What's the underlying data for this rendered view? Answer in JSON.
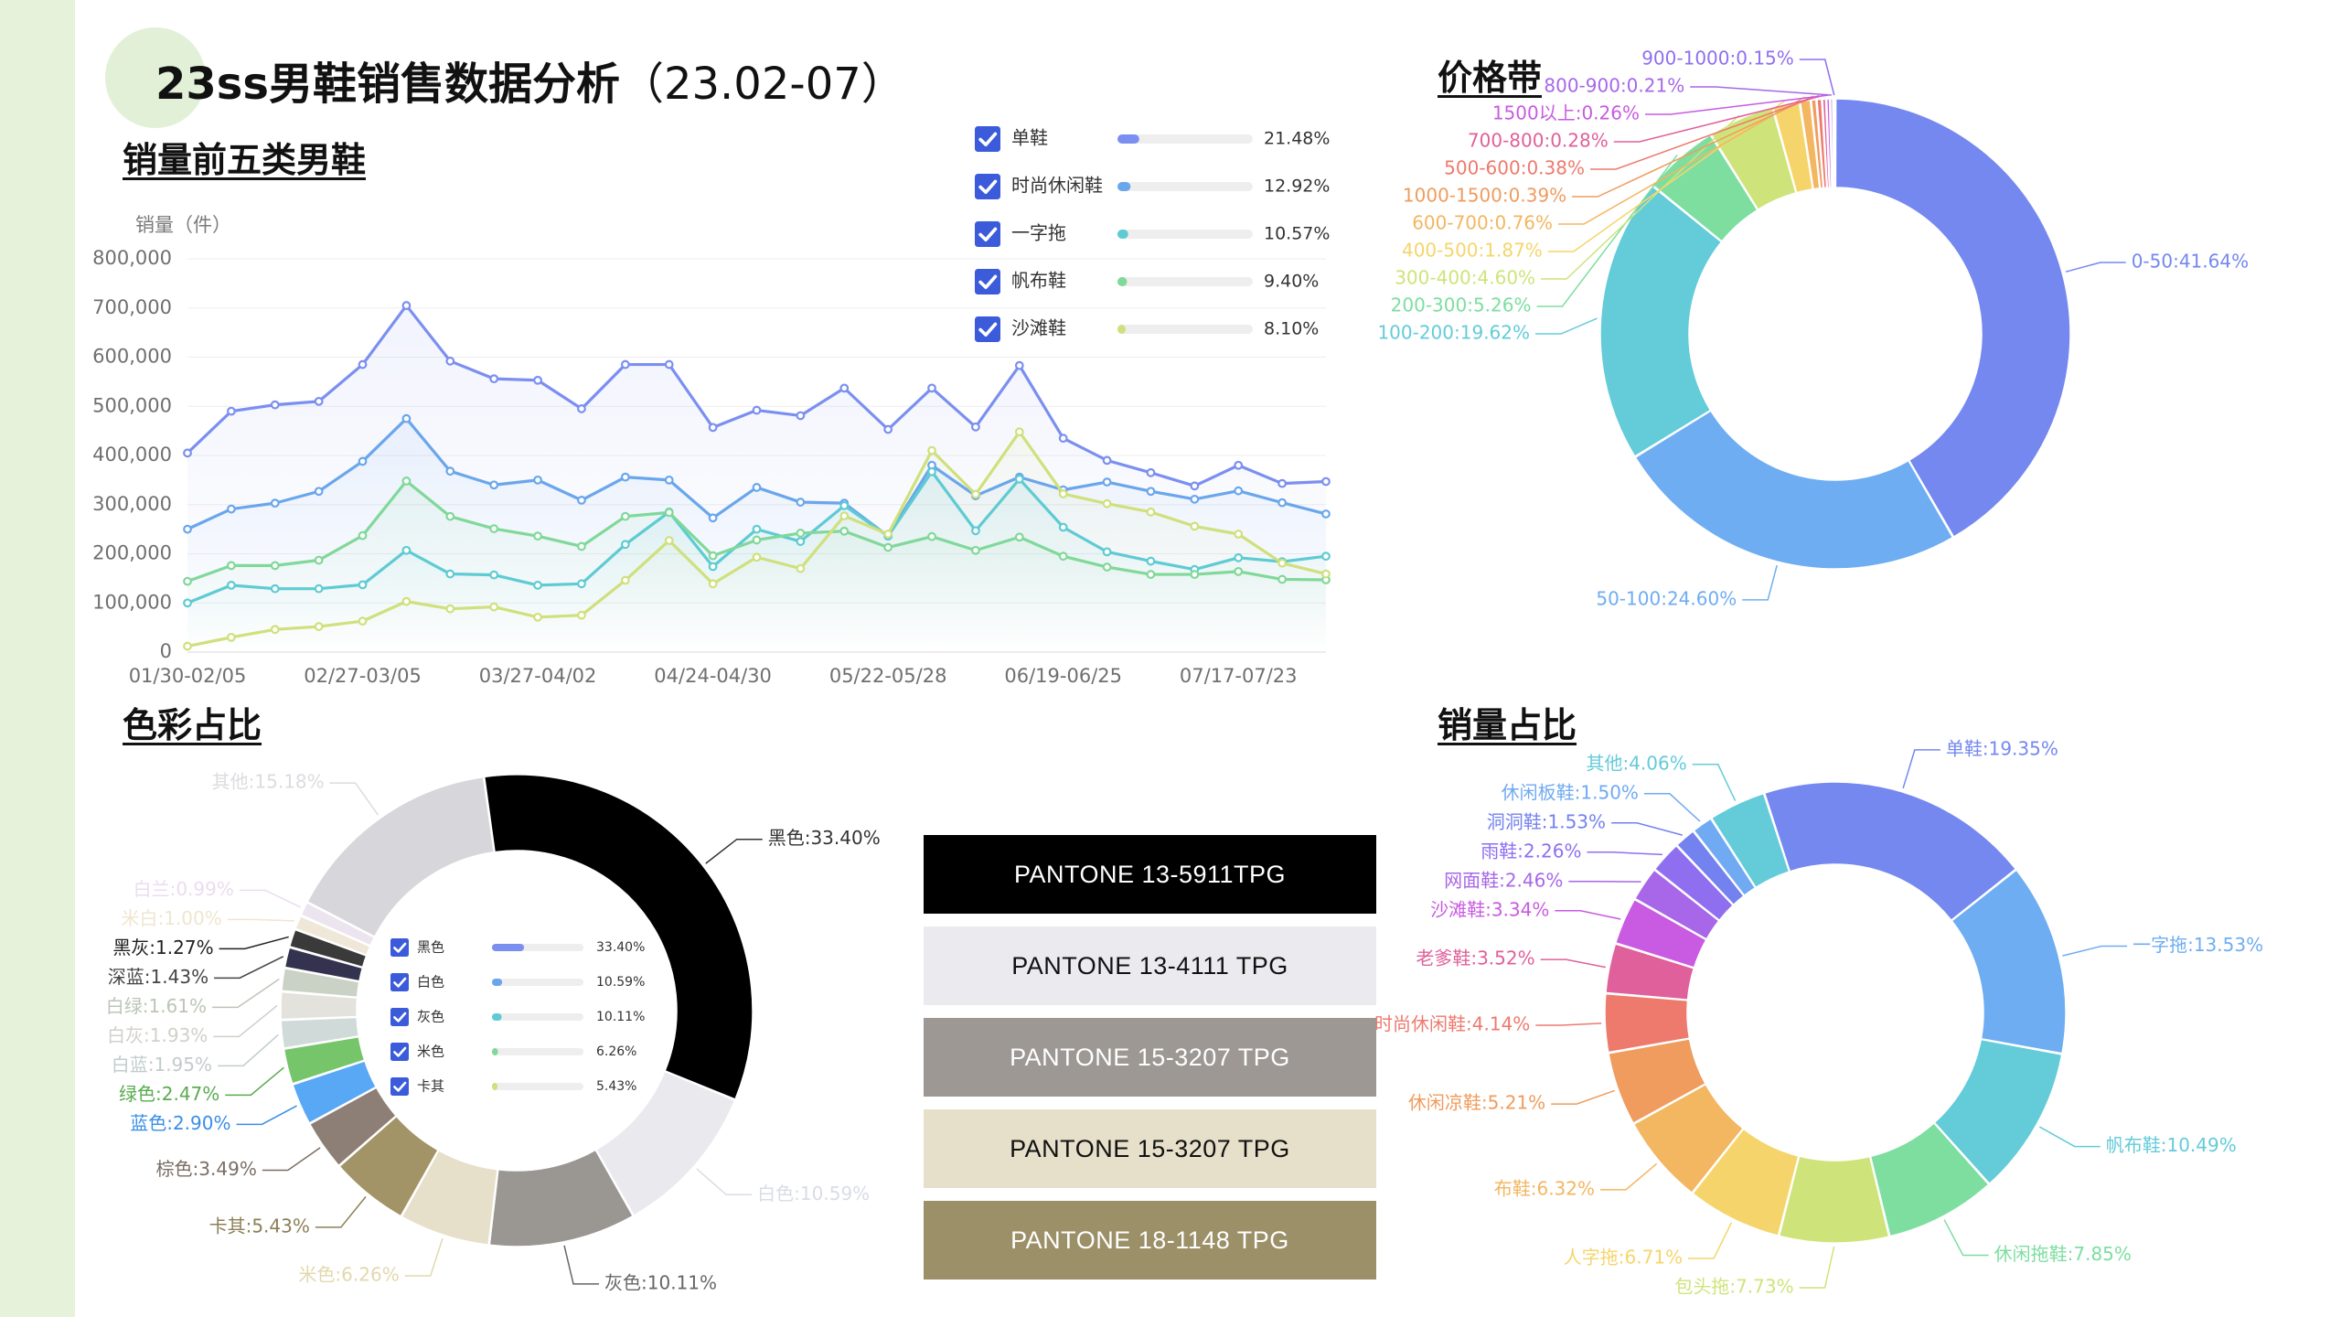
{
  "page": {
    "title_main": "23ss男鞋销售数据分析",
    "title_range": "（23.02-07）"
  },
  "sections": {
    "top5": "销量前五类男鞋",
    "price": "价格带",
    "color": "色彩占比",
    "share": "销量占比"
  },
  "pantone": [
    {
      "label": "PANTONE 13-5911TPG",
      "bg": "#000000",
      "fg": "#ffffff"
    },
    {
      "label": "PANTONE 13-4111 TPG",
      "bg": "#ebebef",
      "fg": "#111111"
    },
    {
      "label": "PANTONE 15-3207 TPG",
      "bg": "#9e9894",
      "fg": "#ffffff"
    },
    {
      "label": "PANTONE 15-3207 TPG",
      "bg": "#e6dfc9",
      "fg": "#111111"
    },
    {
      "label": "PANTONE 18-1148 TPG",
      "bg": "#9c9068",
      "fg": "#ffffff"
    }
  ],
  "chart_data": [
    {
      "id": "line",
      "type": "line",
      "ylabel": "销量（件）",
      "ylim": [
        0,
        800000
      ],
      "yticks": [
        0,
        100000,
        200000,
        300000,
        400000,
        500000,
        600000,
        700000,
        800000
      ],
      "ytick_labels": [
        "0",
        "100,000",
        "200,000",
        "300,000",
        "400,000",
        "500,000",
        "600,000",
        "700,000",
        "800,000"
      ],
      "x_tick_labels": [
        "01/30-02/05",
        "02/27-03/05",
        "03/27-04/02",
        "04/24-04/30",
        "05/22-05/28",
        "06/19-06/25",
        "07/17-07/23"
      ],
      "grid": true,
      "legend_position": "top-right",
      "series": [
        {
          "name": "单鞋",
          "color": "#7b8ff0",
          "pct_label": "21.48%",
          "pct": 21.48,
          "values": [
            405000,
            490000,
            503000,
            510000,
            585000,
            705000,
            592000,
            556000,
            553000,
            495000,
            585000,
            585000,
            457000,
            492000,
            481000,
            537000,
            453000,
            537000,
            458000,
            583000,
            435000,
            390000,
            365000,
            338000,
            380000,
            343000,
            347000
          ]
        },
        {
          "name": "时尚休闲鞋",
          "color": "#6aa6ec",
          "pct_label": "12.92%",
          "pct": 12.92,
          "values": [
            250000,
            291000,
            303000,
            327000,
            388000,
            475000,
            368000,
            340000,
            350000,
            309000,
            356000,
            350000,
            273000,
            335000,
            305000,
            303000,
            236000,
            380000,
            318000,
            356000,
            330000,
            346000,
            327000,
            311000,
            328000,
            304000,
            281000
          ]
        },
        {
          "name": "一字拖",
          "color": "#5ecbd3",
          "pct_label": "10.57%",
          "pct": 10.57,
          "values": [
            100000,
            136000,
            129000,
            129000,
            137000,
            207000,
            159000,
            157000,
            136000,
            139000,
            219000,
            285000,
            174000,
            250000,
            225000,
            298000,
            236000,
            367000,
            247000,
            352000,
            254000,
            204000,
            185000,
            168000,
            192000,
            184000,
            195000
          ]
        },
        {
          "name": "帆布鞋",
          "color": "#80d899",
          "pct_label": "9.40%",
          "pct": 9.4,
          "values": [
            144000,
            176000,
            176000,
            187000,
            237000,
            348000,
            276000,
            251000,
            236000,
            215000,
            276000,
            284000,
            196000,
            228000,
            242000,
            246000,
            213000,
            235000,
            207000,
            234000,
            195000,
            173000,
            158000,
            158000,
            164000,
            148000,
            147000
          ]
        },
        {
          "name": "沙滩鞋",
          "color": "#cfe07c",
          "pct_label": "8.10%",
          "pct": 8.1,
          "values": [
            12000,
            30000,
            46000,
            52000,
            63000,
            103000,
            88000,
            92000,
            71000,
            75000,
            146000,
            227000,
            139000,
            193000,
            170000,
            277000,
            240000,
            410000,
            321000,
            448000,
            322000,
            302000,
            285000,
            256000,
            240000,
            181000,
            159000
          ]
        }
      ]
    },
    {
      "id": "price",
      "type": "pie",
      "donut": true,
      "slices": [
        {
          "label": "0-50:41.64%",
          "value": 41.64,
          "color": "#7488f0"
        },
        {
          "label": "50-100:24.60%",
          "value": 24.6,
          "color": "#6fadf2"
        },
        {
          "label": "100-200:19.62%",
          "value": 19.62,
          "color": "#64cbd9"
        },
        {
          "label": "200-300:5.26%",
          "value": 5.26,
          "color": "#7ddea0"
        },
        {
          "label": "300-400:4.60%",
          "value": 4.6,
          "color": "#cee47a"
        },
        {
          "label": "400-500:1.87%",
          "value": 1.87,
          "color": "#f5d56b"
        },
        {
          "label": "600-700:0.76%",
          "value": 0.76,
          "color": "#f3b661"
        },
        {
          "label": "1000-1500:0.39%",
          "value": 0.39,
          "color": "#ef9c5e"
        },
        {
          "label": "500-600:0.38%",
          "value": 0.38,
          "color": "#ee7a6e"
        },
        {
          "label": "700-800:0.28%",
          "value": 0.28,
          "color": "#e0609b"
        },
        {
          "label": "1500以上:0.26%",
          "value": 0.26,
          "color": "#c95ae2"
        },
        {
          "label": "800-900:0.21%",
          "value": 0.21,
          "color": "#a767e8"
        },
        {
          "label": "900-1000:0.15%",
          "value": 0.15,
          "color": "#8f6ff0"
        }
      ]
    },
    {
      "id": "color",
      "type": "pie",
      "donut": true,
      "legend_position": "inside-center",
      "slices": [
        {
          "label": "黑色:33.40%",
          "value": 33.4,
          "color": "#000000",
          "label_color": "#333333"
        },
        {
          "label": "白色:10.59%",
          "value": 10.59,
          "color": "#e9e9ee",
          "label_color": "#d9dce6"
        },
        {
          "label": "灰色:10.11%",
          "value": 10.11,
          "color": "#9a9692",
          "label_color": "#666666"
        },
        {
          "label": "米色:6.26%",
          "value": 6.26,
          "color": "#e6dfc9",
          "label_color": "#e2d8ad"
        },
        {
          "label": "卡其:5.43%",
          "value": 5.43,
          "color": "#a39468",
          "label_color": "#8c7f57"
        },
        {
          "label": "棕色:3.49%",
          "value": 3.49,
          "color": "#8d7f75",
          "label_color": "#7a6e64"
        },
        {
          "label": "蓝色:2.90%",
          "value": 2.9,
          "color": "#58a8f5",
          "label_color": "#3a8ee6"
        },
        {
          "label": "绿色:2.47%",
          "value": 2.47,
          "color": "#76c56a",
          "label_color": "#5aab4f"
        },
        {
          "label": "白蓝:1.95%",
          "value": 1.95,
          "color": "#cfdad9",
          "label_color": "#c2cccc"
        },
        {
          "label": "白灰:1.93%",
          "value": 1.93,
          "color": "#e4e2dd",
          "label_color": "#d2d0cb"
        },
        {
          "label": "白绿:1.61%",
          "value": 1.61,
          "color": "#c9d2c5",
          "label_color": "#bcc5b8"
        },
        {
          "label": "深蓝:1.43%",
          "value": 1.43,
          "color": "#33334f",
          "label_color": "#444444"
        },
        {
          "label": "黑灰:1.27%",
          "value": 1.27,
          "color": "#3a3a3a",
          "label_color": "#222222"
        },
        {
          "label": "米白:1.00%",
          "value": 1.0,
          "color": "#efe8d8",
          "label_color": "#efe6cf"
        },
        {
          "label": "白兰:0.99%",
          "value": 0.99,
          "color": "#ece4ee",
          "label_color": "#eadcf0"
        },
        {
          "label": "其他:15.18%",
          "value": 15.18,
          "color": "#d7d7db",
          "label_color": "#dcdce0"
        }
      ],
      "legend": [
        {
          "name": "黑色",
          "pct_label": "33.40%",
          "pct": 33.4,
          "color": "#7b8ff0"
        },
        {
          "name": "白色",
          "pct_label": "10.59%",
          "pct": 10.59,
          "color": "#6aa6ec"
        },
        {
          "name": "灰色",
          "pct_label": "10.11%",
          "pct": 10.11,
          "color": "#5ecbd3"
        },
        {
          "name": "米色",
          "pct_label": "6.26%",
          "pct": 6.26,
          "color": "#80d899"
        },
        {
          "name": "卡其",
          "pct_label": "5.43%",
          "pct": 5.43,
          "color": "#cfe07c"
        }
      ]
    },
    {
      "id": "share",
      "type": "pie",
      "donut": true,
      "slices": [
        {
          "label": "单鞋:19.35%",
          "value": 19.35,
          "color": "#7488f0"
        },
        {
          "label": "一字拖:13.53%",
          "value": 13.53,
          "color": "#6fadf2"
        },
        {
          "label": "帆布鞋:10.49%",
          "value": 10.49,
          "color": "#64cbd9"
        },
        {
          "label": "休闲拖鞋:7.85%",
          "value": 7.85,
          "color": "#7ddea0"
        },
        {
          "label": "包头拖:7.73%",
          "value": 7.73,
          "color": "#cee47a"
        },
        {
          "label": "人字拖:6.71%",
          "value": 6.71,
          "color": "#f5d56b"
        },
        {
          "label": "布鞋:6.32%",
          "value": 6.32,
          "color": "#f3b661"
        },
        {
          "label": "休闲凉鞋:5.21%",
          "value": 5.21,
          "color": "#ef9c5e"
        },
        {
          "label": "时尚休闲鞋:4.14%",
          "value": 4.14,
          "color": "#ee7a6e"
        },
        {
          "label": "老爹鞋:3.52%",
          "value": 3.52,
          "color": "#e0609b"
        },
        {
          "label": "沙滩鞋:3.34%",
          "value": 3.34,
          "color": "#c95ae2"
        },
        {
          "label": "网面鞋:2.46%",
          "value": 2.46,
          "color": "#a767e8"
        },
        {
          "label": "雨鞋:2.26%",
          "value": 2.26,
          "color": "#8f6ff0"
        },
        {
          "label": "洞洞鞋:1.53%",
          "value": 1.53,
          "color": "#7482ef"
        },
        {
          "label": "休闲板鞋:1.50%",
          "value": 1.5,
          "color": "#70aaf2"
        },
        {
          "label": "其他:4.06%",
          "value": 4.06,
          "color": "#64cbd9"
        }
      ]
    }
  ]
}
